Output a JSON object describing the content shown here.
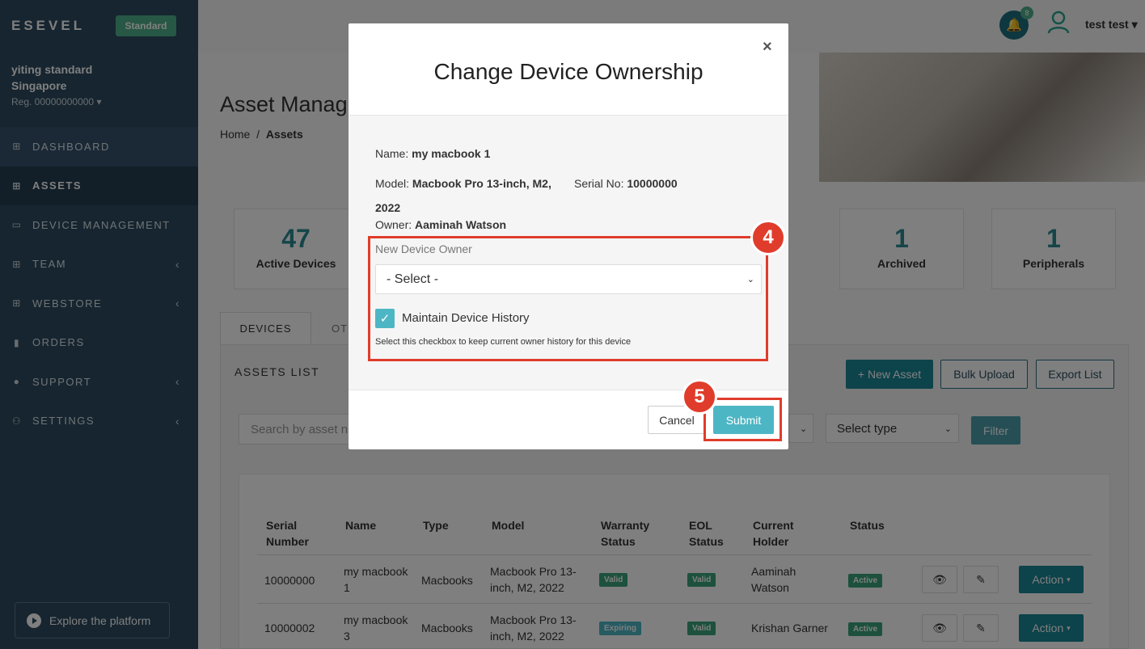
{
  "sidebar": {
    "brand": "ESEVEL",
    "plan": "Standard",
    "org_line1": "yiting standard",
    "org_line2": "Singapore",
    "reg": "Reg. 00000000000",
    "items": [
      {
        "label": "DASHBOARD",
        "icon": "grid-icon"
      },
      {
        "label": "ASSETS",
        "icon": "grid-icon"
      },
      {
        "label": "DEVICE MANAGEMENT",
        "icon": "laptop-icon"
      },
      {
        "label": "TEAM",
        "icon": "grid-icon"
      },
      {
        "label": "WEBSTORE",
        "icon": "grid-icon"
      },
      {
        "label": "ORDERS",
        "icon": "file-icon"
      },
      {
        "label": "SUPPORT",
        "icon": "info-icon"
      },
      {
        "label": "SETTINGS",
        "icon": "users-icon"
      }
    ],
    "explore": "Explore the platform"
  },
  "topbar": {
    "notification_count": "8",
    "user_name": "test test"
  },
  "page": {
    "title": "Asset Manag",
    "breadcrumb_home": "Home",
    "breadcrumb_sep": "/",
    "breadcrumb_current": "Assets",
    "stats": [
      {
        "value": "47",
        "label": "Active Devices"
      },
      {
        "value": "1",
        "label": "Archived"
      },
      {
        "value": "1",
        "label": "Peripherals"
      }
    ],
    "tabs": [
      "DEVICES",
      "OT"
    ],
    "assets_list_title": "ASSETS LIST",
    "buttons": {
      "new_asset": "+ New Asset",
      "bulk_upload": "Bulk Upload",
      "export_list": "Export List",
      "filter": "Filter"
    },
    "search_placeholder": "Search by asset n",
    "select_type": "Select type",
    "table": {
      "headers": [
        "Serial Number",
        "Name",
        "Type",
        "Model",
        "Warranty Status",
        "EOL Status",
        "Current Holder",
        "Status"
      ],
      "rows": [
        {
          "serial": "10000000",
          "name": "my macbook 1",
          "type": "Macbooks",
          "model": "Macbook Pro 13-inch, M2, 2022",
          "warranty": "Valid",
          "eol": "Valid",
          "holder": "Aaminah Watson",
          "status": "Active",
          "action": "Action"
        },
        {
          "serial": "10000002",
          "name": "my macbook 3",
          "type": "Macbooks",
          "model": "Macbook Pro 13-inch, M2, 2022",
          "warranty": "Expiring",
          "eol": "Valid",
          "holder": "Krishan Garner",
          "status": "Active",
          "action": "Action"
        }
      ]
    }
  },
  "modal": {
    "title": "Change Device Ownership",
    "close": "×",
    "name_label": "Name:",
    "name_value": "my macbook 1",
    "model_label": "Model:",
    "model_value_line1": "Macbook Pro 13-inch, M2,",
    "model_value_line2": "2022",
    "serial_label": "Serial No:",
    "serial_value": "10000000",
    "owner_label": "Owner:",
    "owner_value": "Aaminah Watson",
    "new_owner_label": "New Device Owner",
    "select_value": "- Select -",
    "checkbox_label": "Maintain Device History",
    "checkbox_checked": true,
    "checkbox_hint": "Select this checkbox to keep current owner history for this device",
    "cancel": "Cancel",
    "submit": "Submit"
  },
  "callouts": [
    "4",
    "5"
  ],
  "colors": {
    "sidebar": "#2d4a5f",
    "accent": "#4db6c4",
    "primary": "#1b8796",
    "callout": "#e03c2b",
    "success": "#3aa37a"
  }
}
